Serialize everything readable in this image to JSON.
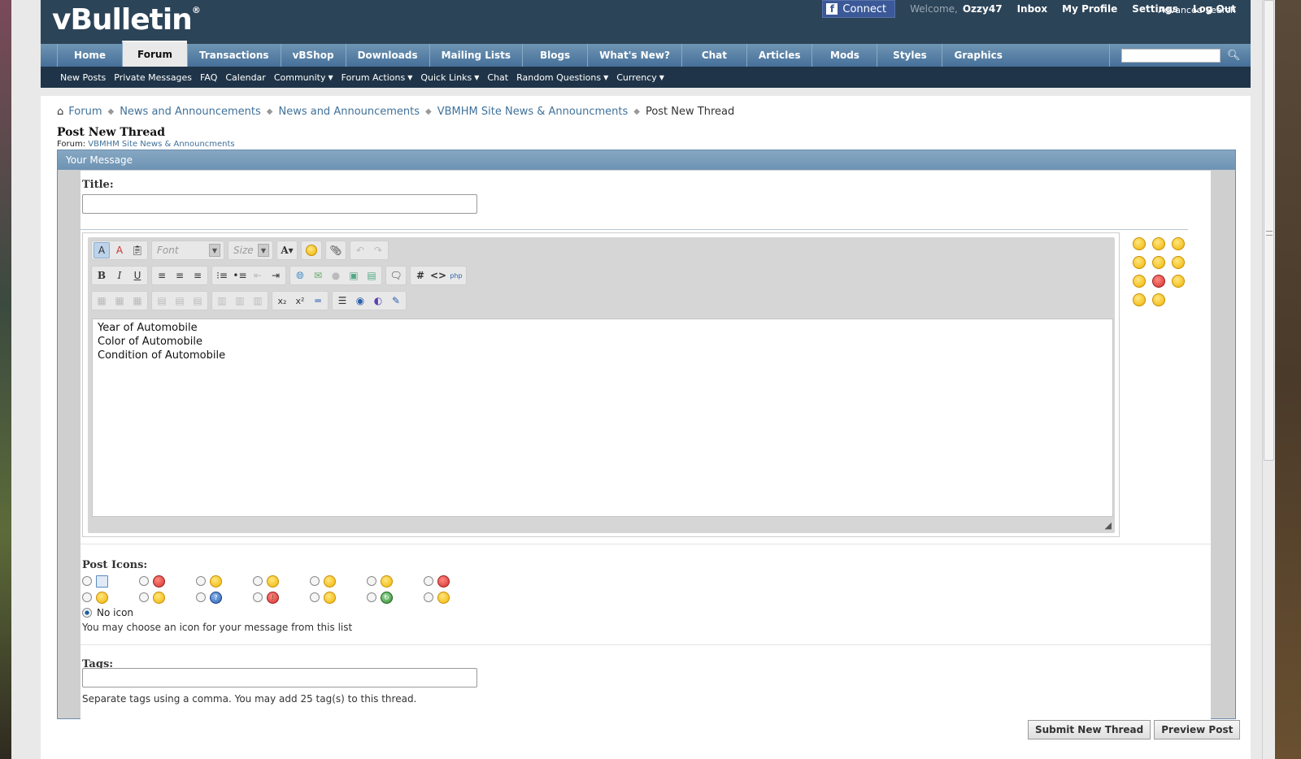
{
  "header": {
    "logo": "vBulletin",
    "logo_mark": "®",
    "fb_connect": "Connect",
    "welcome": "Welcome,",
    "username": "Ozzy47",
    "links": [
      "Inbox",
      "My Profile",
      "Settings",
      "Log Out"
    ]
  },
  "nav": {
    "tabs": [
      "Home",
      "Forum",
      "Transactions",
      "vBShop",
      "Downloads",
      "Mailing Lists",
      "Blogs",
      "What's New?",
      "Chat",
      "Articles",
      "Mods",
      "Styles",
      "Graphics"
    ],
    "active_tab": "Forum",
    "search_placeholder": ""
  },
  "subnav": {
    "items": [
      {
        "label": "New Posts",
        "dropdown": false
      },
      {
        "label": "Private Messages",
        "dropdown": false
      },
      {
        "label": "FAQ",
        "dropdown": false
      },
      {
        "label": "Calendar",
        "dropdown": false
      },
      {
        "label": "Community",
        "dropdown": true
      },
      {
        "label": "Forum Actions",
        "dropdown": true
      },
      {
        "label": "Quick Links",
        "dropdown": true
      },
      {
        "label": "Chat",
        "dropdown": false
      },
      {
        "label": "Random Questions",
        "dropdown": true
      },
      {
        "label": "Currency",
        "dropdown": true
      }
    ],
    "advanced_search": "Advanced Search"
  },
  "breadcrumb": {
    "items": [
      "Forum",
      "News and Announcements",
      "News and Announcements",
      "VBMHM Site News & Announcments"
    ],
    "current": "Post New Thread"
  },
  "page": {
    "title": "Post New Thread",
    "forum_label": "Forum:",
    "forum_name": "VBMHM Site News & Announcments"
  },
  "form": {
    "section_title": "Your Message",
    "title_label": "Title:",
    "title_value": "",
    "editor": {
      "font_placeholder": "Font",
      "size_placeholder": "Size",
      "text": "Year of Automobile\nColor of Automobile\nCondition of Automobile"
    },
    "post_icons_label": "Post Icons:",
    "no_icon_label": "No icon",
    "post_icons_hint": "You may choose an icon for your message from this list",
    "tags_label": "Tags:",
    "tags_value": "",
    "tags_hint": "Separate tags using a comma. You may add 25 tag(s) to this thread.",
    "submit_label": "Submit New Thread",
    "preview_label": "Preview Post"
  },
  "post_icons": [
    {
      "name": "document-icon",
      "style": "doc",
      "glyph": ""
    },
    {
      "name": "thumbs-down-icon",
      "style": "red",
      "glyph": ""
    },
    {
      "name": "smile-icon",
      "style": "",
      "glyph": ""
    },
    {
      "name": "grin-icon",
      "style": "",
      "glyph": ""
    },
    {
      "name": "wink-icon",
      "style": "",
      "glyph": ""
    },
    {
      "name": "frown-icon",
      "style": "",
      "glyph": ""
    },
    {
      "name": "mad-icon",
      "style": "red",
      "glyph": ""
    },
    {
      "name": "wink-tongue-icon",
      "style": "",
      "glyph": ""
    },
    {
      "name": "cool-icon",
      "style": "",
      "glyph": ""
    },
    {
      "name": "question-icon",
      "style": "blue",
      "glyph": "?"
    },
    {
      "name": "exclamation-icon",
      "style": "red",
      "glyph": "!"
    },
    {
      "name": "lightbulb-icon",
      "style": "",
      "glyph": ""
    },
    {
      "name": "redface-icon",
      "style": "green",
      "glyph": "↻"
    },
    {
      "name": "thumbs-up-icon",
      "style": "",
      "glyph": ""
    }
  ],
  "smilies": [
    {
      "name": "smilie-wink-icon",
      "style": ""
    },
    {
      "name": "smilie-biggrin-icon",
      "style": ""
    },
    {
      "name": "smilie-grin-icon",
      "style": ""
    },
    {
      "name": "smilie-smile-icon",
      "style": ""
    },
    {
      "name": "smilie-tongue-icon",
      "style": ""
    },
    {
      "name": "smilie-frown-icon",
      "style": ""
    },
    {
      "name": "smilie-confused-icon",
      "style": ""
    },
    {
      "name": "smilie-mad-icon",
      "style": "red"
    },
    {
      "name": "smilie-redface-icon",
      "style": ""
    },
    {
      "name": "smilie-cool-icon",
      "style": ""
    },
    {
      "name": "smilie-rolleyes-icon",
      "style": ""
    }
  ],
  "colors": {
    "header_bg": "#2c4458",
    "nav_bg": "#5a82a6",
    "link": "#40719a"
  }
}
